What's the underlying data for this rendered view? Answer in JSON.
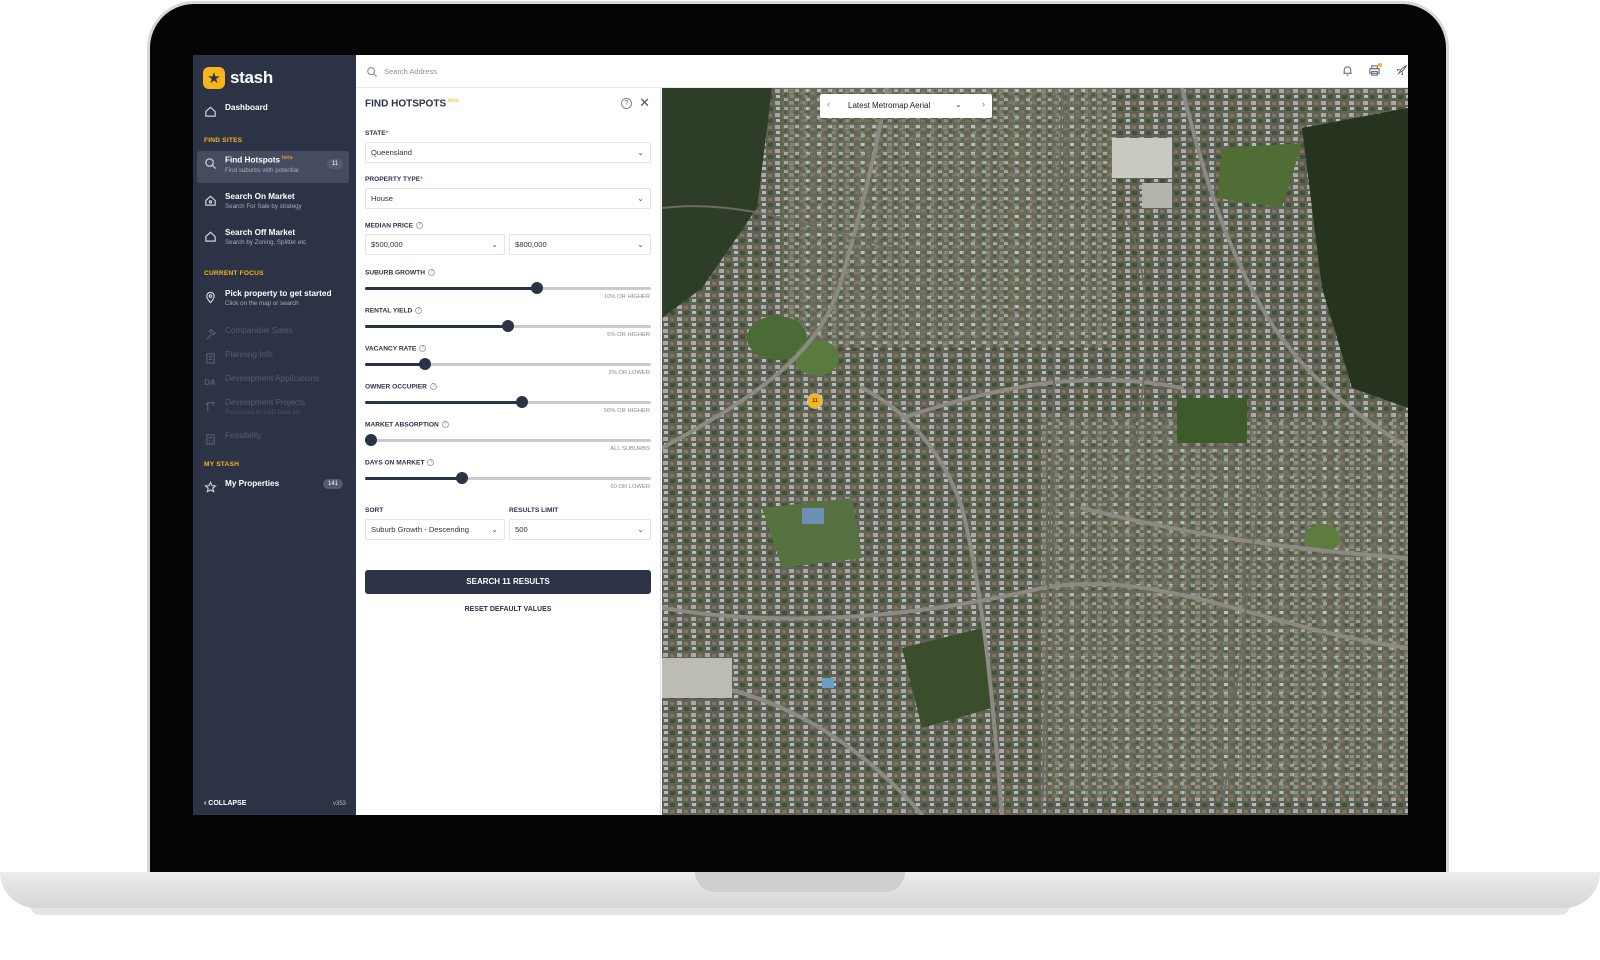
{
  "app": {
    "logo_text": "stash",
    "version": "v353"
  },
  "sidebar": {
    "dashboard_label": "Dashboard",
    "find_sites_title": "FIND SITES",
    "find_sites": [
      {
        "label": "Find Hotspots",
        "beta": "beta",
        "sub": "Find suburbs with potential",
        "badge": "11",
        "icon": "search-icon"
      },
      {
        "label": "Search On Market",
        "sub": "Search For Sale by strategy",
        "icon": "house-icon"
      },
      {
        "label": "Search Off Market",
        "sub": "Search by Zoning, Splitter etc",
        "icon": "house-icon"
      }
    ],
    "current_focus_title": "CURRENT FOCUS",
    "current_focus": [
      {
        "label": "Pick property to get started",
        "sub": "Click on the map or search",
        "icon": "pin-icon"
      },
      {
        "label": "Comparable Sales",
        "icon": "hammer-icon"
      },
      {
        "label": "Planning Info",
        "icon": "building-icon"
      },
      {
        "label": "Development Applications",
        "icon_text": "DA"
      },
      {
        "label": "Development Projects",
        "sub": "Resources to S&D Data etc",
        "icon": "crane-icon"
      },
      {
        "label": "Feasibility",
        "icon": "calculator-icon"
      }
    ],
    "my_stash_title": "MY STASH",
    "my_properties_label": "My Properties",
    "my_properties_badge": "141",
    "collapse_label": "COLLAPSE"
  },
  "topbar": {
    "search_placeholder": "Search Address"
  },
  "panel": {
    "title": "FIND HOTSPOTS",
    "title_badge": "beta",
    "state_label": "STATE",
    "state_value": "Queensland",
    "property_type_label": "PROPERTY TYPE",
    "property_type_value": "House",
    "median_price_label": "MEDIAN PRICE",
    "median_price_min": "$500,000",
    "median_price_max": "$800,000",
    "sliders": [
      {
        "label": "SUBURB GROWTH",
        "value": 0.6,
        "caption": "10% OR HIGHER"
      },
      {
        "label": "RENTAL YIELD",
        "value": 0.5,
        "caption": "5% OR HIGHER"
      },
      {
        "label": "VACANCY RATE",
        "value": 0.21,
        "caption": "2% OR LOWER"
      },
      {
        "label": "OWNER OCCUPIER",
        "value": 0.55,
        "caption": "50% OR HIGHER"
      },
      {
        "label": "MARKET ABSORPTION",
        "value": 0.02,
        "caption": "ALL SUBURBS"
      },
      {
        "label": "DAYS ON MARKET",
        "value": 0.34,
        "caption": "60 OR LOWER"
      }
    ],
    "sort_label": "SORT",
    "sort_value": "Suburb Growth - Descending",
    "results_limit_label": "RESULTS LIMIT",
    "results_limit_value": "500",
    "search_button": "SEARCH 11 RESULTS",
    "reset_link": "RESET DEFAULT VALUES"
  },
  "map": {
    "layer_label": "Latest Metromap Aerial",
    "marker_label": "11"
  },
  "colors": {
    "sidebar_bg": "#2d3346",
    "accent": "#f5b51b",
    "button_bg": "#2d3346"
  }
}
